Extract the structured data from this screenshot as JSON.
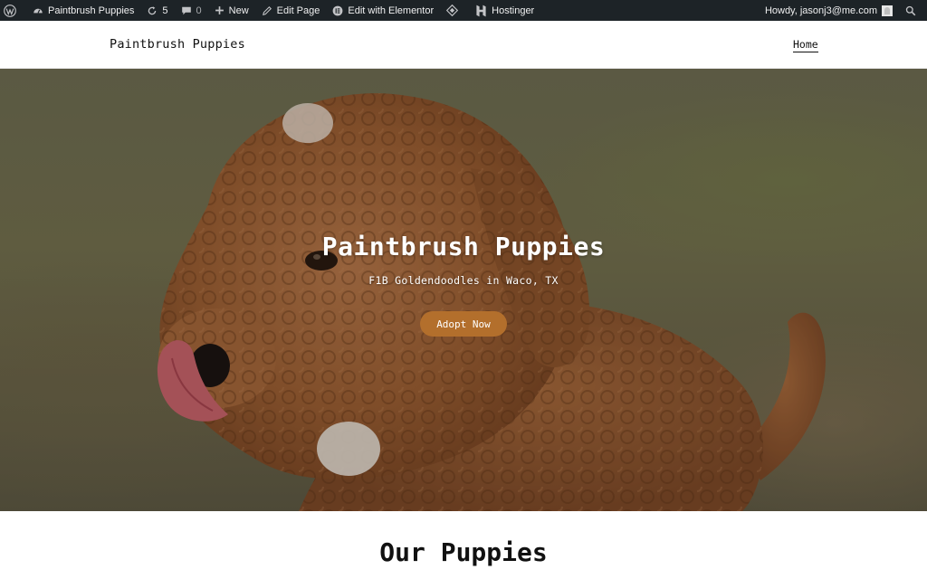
{
  "admin_bar": {
    "site_name": "Paintbrush Puppies",
    "updates_count": "5",
    "comments_count": "0",
    "new_label": "New",
    "edit_page_label": "Edit Page",
    "elementor_label": "Edit with Elementor",
    "hostinger_label": "Hostinger",
    "greeting": "Howdy, jasonj3@me.com"
  },
  "header": {
    "site_title": "Paintbrush Puppies",
    "nav": [
      "Home"
    ]
  },
  "hero": {
    "title": "Paintbrush Puppies",
    "subtitle": "F1B Goldendoodles in Waco, TX",
    "cta_label": "Adopt Now",
    "cta_color": "#b36f2c"
  },
  "section": {
    "title": "Our Puppies"
  },
  "colors": {
    "admin_bar": "#1d2327",
    "puppy_fur": "#a8683a"
  }
}
